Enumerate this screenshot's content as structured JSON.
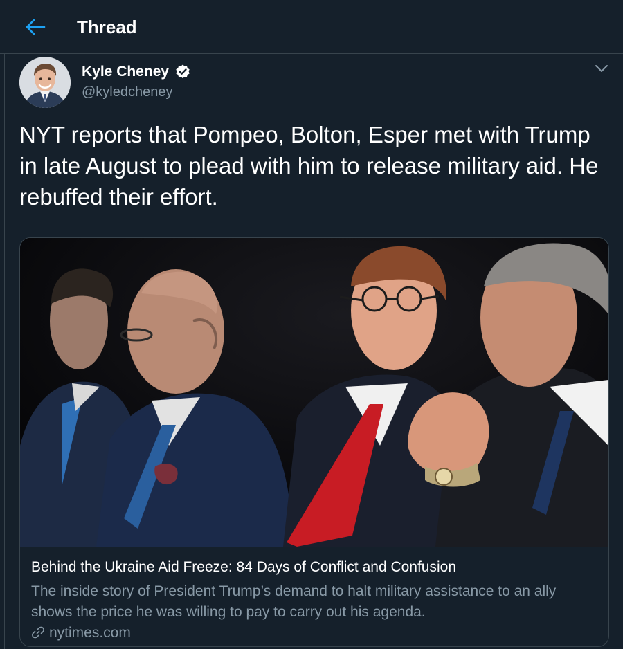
{
  "header": {
    "title": "Thread",
    "back_icon": "arrow-left-icon"
  },
  "tweet": {
    "author_name": "Kyle Cheney",
    "handle": "@kyledcheney",
    "verified": true,
    "verified_icon": "verified-badge-icon",
    "menu_icon": "chevron-down-icon",
    "text": "NYT reports that Pompeo, Bolton, Esper met with Trump in late August to plead with him to release military aid. He rebuffed their effort."
  },
  "card": {
    "title": "Behind the Ukraine Aid Freeze: 84 Days of Conflict and Confusion",
    "description": "The inside story of President Trump’s demand to halt military assistance to an ally shows the price he was willing to pay to carry out his agenda.",
    "domain": "nytimes.com",
    "link_icon": "link-icon"
  },
  "colors": {
    "background": "#15202b",
    "border": "#38444d",
    "accent": "#1da1f2",
    "secondary_text": "#8899a6",
    "primary_text": "#ffffff"
  }
}
